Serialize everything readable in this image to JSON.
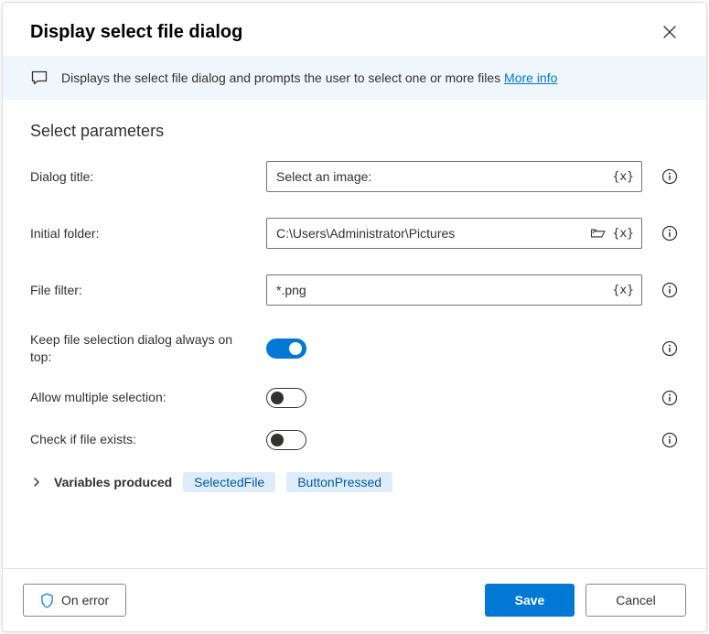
{
  "dialog": {
    "title": "Display select file dialog"
  },
  "banner": {
    "text": "Displays the select file dialog and prompts the user to select one or more files ",
    "link": "More info"
  },
  "section": {
    "heading": "Select parameters"
  },
  "fields": {
    "dialog_title": {
      "label": "Dialog title:",
      "value": "Select an image:"
    },
    "initial_folder": {
      "label": "Initial folder:",
      "value": "C:\\Users\\Administrator\\Pictures"
    },
    "file_filter": {
      "label": "File filter:",
      "value": "*.png"
    },
    "always_on_top": {
      "label": "Keep file selection dialog always on top:",
      "value": true
    },
    "allow_multiple": {
      "label": "Allow multiple selection:",
      "value": false
    },
    "check_exists": {
      "label": "Check if file exists:",
      "value": false
    }
  },
  "variables": {
    "label": "Variables produced",
    "chips": [
      "SelectedFile",
      "ButtonPressed"
    ]
  },
  "footer": {
    "on_error": "On error",
    "save": "Save",
    "cancel": "Cancel"
  },
  "glyphs": {
    "var_token": "{x}"
  }
}
